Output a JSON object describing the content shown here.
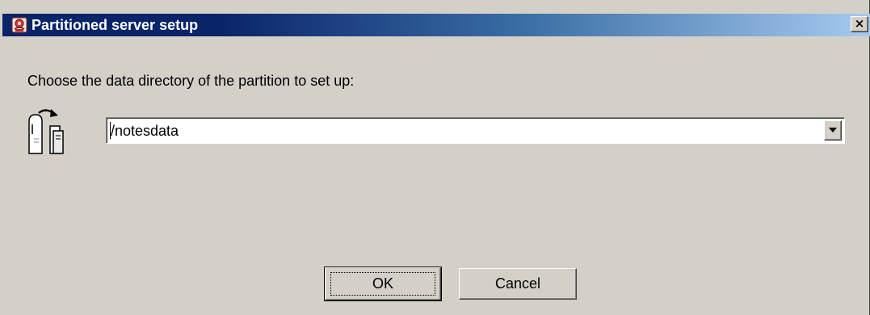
{
  "window": {
    "title": "Partitioned server setup",
    "close_label": "×"
  },
  "content": {
    "prompt": "Choose the data directory of the partition to set up:",
    "directory_select": {
      "value": "/notesdata"
    }
  },
  "buttons": {
    "ok_label": "OK",
    "cancel_label": "Cancel"
  },
  "icons": {
    "app": "notes-server-icon",
    "partition": "partitioned-server-icon",
    "dropdown": "chevron-down-icon"
  },
  "colors": {
    "title_start": "#0a246a",
    "title_end": "#a6caf0",
    "dialog_bg": "#d4d0c8"
  }
}
